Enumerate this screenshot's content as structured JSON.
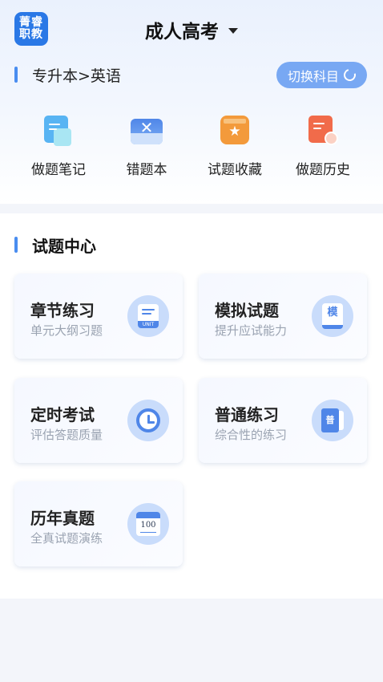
{
  "app": {
    "logo_line1": "菁睿",
    "logo_line2": "职教"
  },
  "header": {
    "title": "成人高考"
  },
  "subject": {
    "path": "专升本>英语",
    "switch_label": "切换科目"
  },
  "tools": [
    {
      "label": "做题笔记",
      "icon": "note-icon"
    },
    {
      "label": "错题本",
      "icon": "wrong-book-icon"
    },
    {
      "label": "试题收藏",
      "icon": "favorite-icon"
    },
    {
      "label": "做题历史",
      "icon": "history-icon"
    }
  ],
  "center": {
    "title": "试题中心",
    "cards": [
      {
        "title": "章节练习",
        "subtitle": "单元大纲习题",
        "icon": "unit-book-icon",
        "icon_text": "UNIT"
      },
      {
        "title": "模拟试题",
        "subtitle": "提升应试能力",
        "icon": "mock-exam-icon",
        "icon_text": "模"
      },
      {
        "title": "定时考试",
        "subtitle": "评估答题质量",
        "icon": "clock-icon"
      },
      {
        "title": "普通练习",
        "subtitle": "综合性的练习",
        "icon": "practice-book-icon",
        "icon_text": "普"
      },
      {
        "title": "历年真题",
        "subtitle": "全真试题演练",
        "icon": "calendar-100-icon",
        "icon_text": "100"
      }
    ]
  },
  "colors": {
    "accent": "#4a8df0",
    "switch_bg": "#78a8f3",
    "icon_bg": "#c9dcfb"
  }
}
